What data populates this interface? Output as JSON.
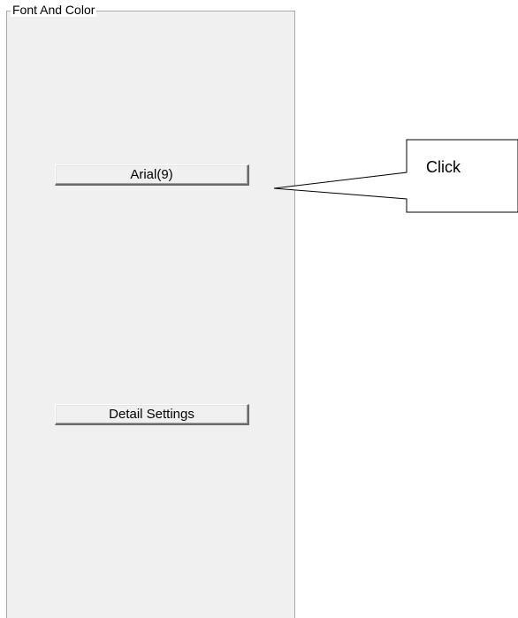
{
  "groupbox": {
    "title": "Font And Color"
  },
  "buttons": {
    "font_label": "Arial(9)",
    "detail_label": "Detail Settings"
  },
  "callout": {
    "text": "Click"
  }
}
